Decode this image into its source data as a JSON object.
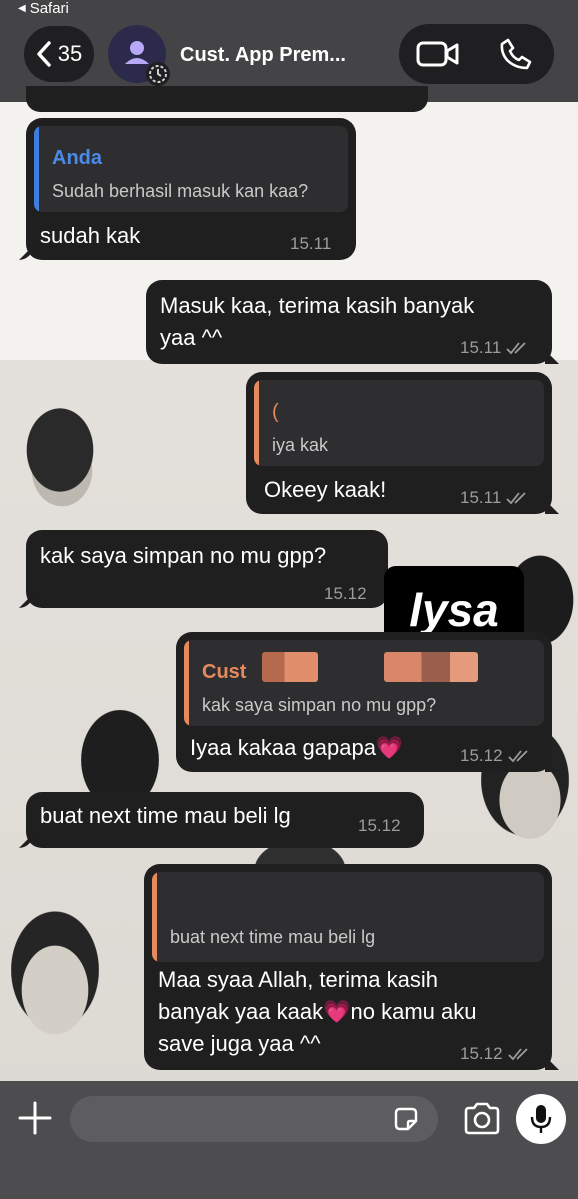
{
  "status_bar": {
    "back_app": "Safari"
  },
  "header": {
    "back_count": "35",
    "chat_title": "Cust. App Prem...",
    "icons": [
      "chevron-left-icon",
      "person-icon",
      "timer-icon",
      "video-camera-icon",
      "phone-icon"
    ]
  },
  "messages": [
    {
      "direction": "incoming",
      "quote_author": "Anda",
      "quote_text": "Sudah berhasil masuk kan kaa?",
      "text": "sudah kak",
      "time": "15.11"
    },
    {
      "direction": "outgoing",
      "text_line1": "Masuk kaa, terima kasih banyak",
      "text_line2": "yaa ^^",
      "time": "15.11",
      "status": "read"
    },
    {
      "direction": "outgoing",
      "quote_author": "(",
      "quote_text": "iya kak",
      "text": "Okeey kaak!",
      "time": "15.11",
      "status": "read"
    },
    {
      "direction": "incoming",
      "text": "kak saya simpan no mu gpp?",
      "time": "15.12"
    },
    {
      "direction": "outgoing",
      "quote_author": "Cust",
      "quote_text": "kak saya simpan no mu gpp?",
      "text": "Iyaa kakaa gapapa💗",
      "time": "15.12",
      "status": "read"
    },
    {
      "direction": "incoming",
      "text": "buat next time mau beli lg",
      "time": "15.12"
    },
    {
      "direction": "outgoing",
      "quote_text": "buat next time mau beli lg",
      "text_line1": "Maa syaa Allah, terima kasih",
      "text_line2": "banyak yaa kaak💗no kamu aku",
      "text_line3": "save juga yaa ^^",
      "time": "15.12",
      "status": "read"
    }
  ],
  "overlay_label": "lysa",
  "colors": {
    "bubble": "#1f1f20",
    "quote_blue": "#3f7de0",
    "quote_orange": "#e5895e",
    "header": "#3c3c3e"
  },
  "input_bar": {
    "icons": [
      "plus-icon",
      "sticker-icon",
      "camera-icon",
      "microphone-icon"
    ]
  }
}
